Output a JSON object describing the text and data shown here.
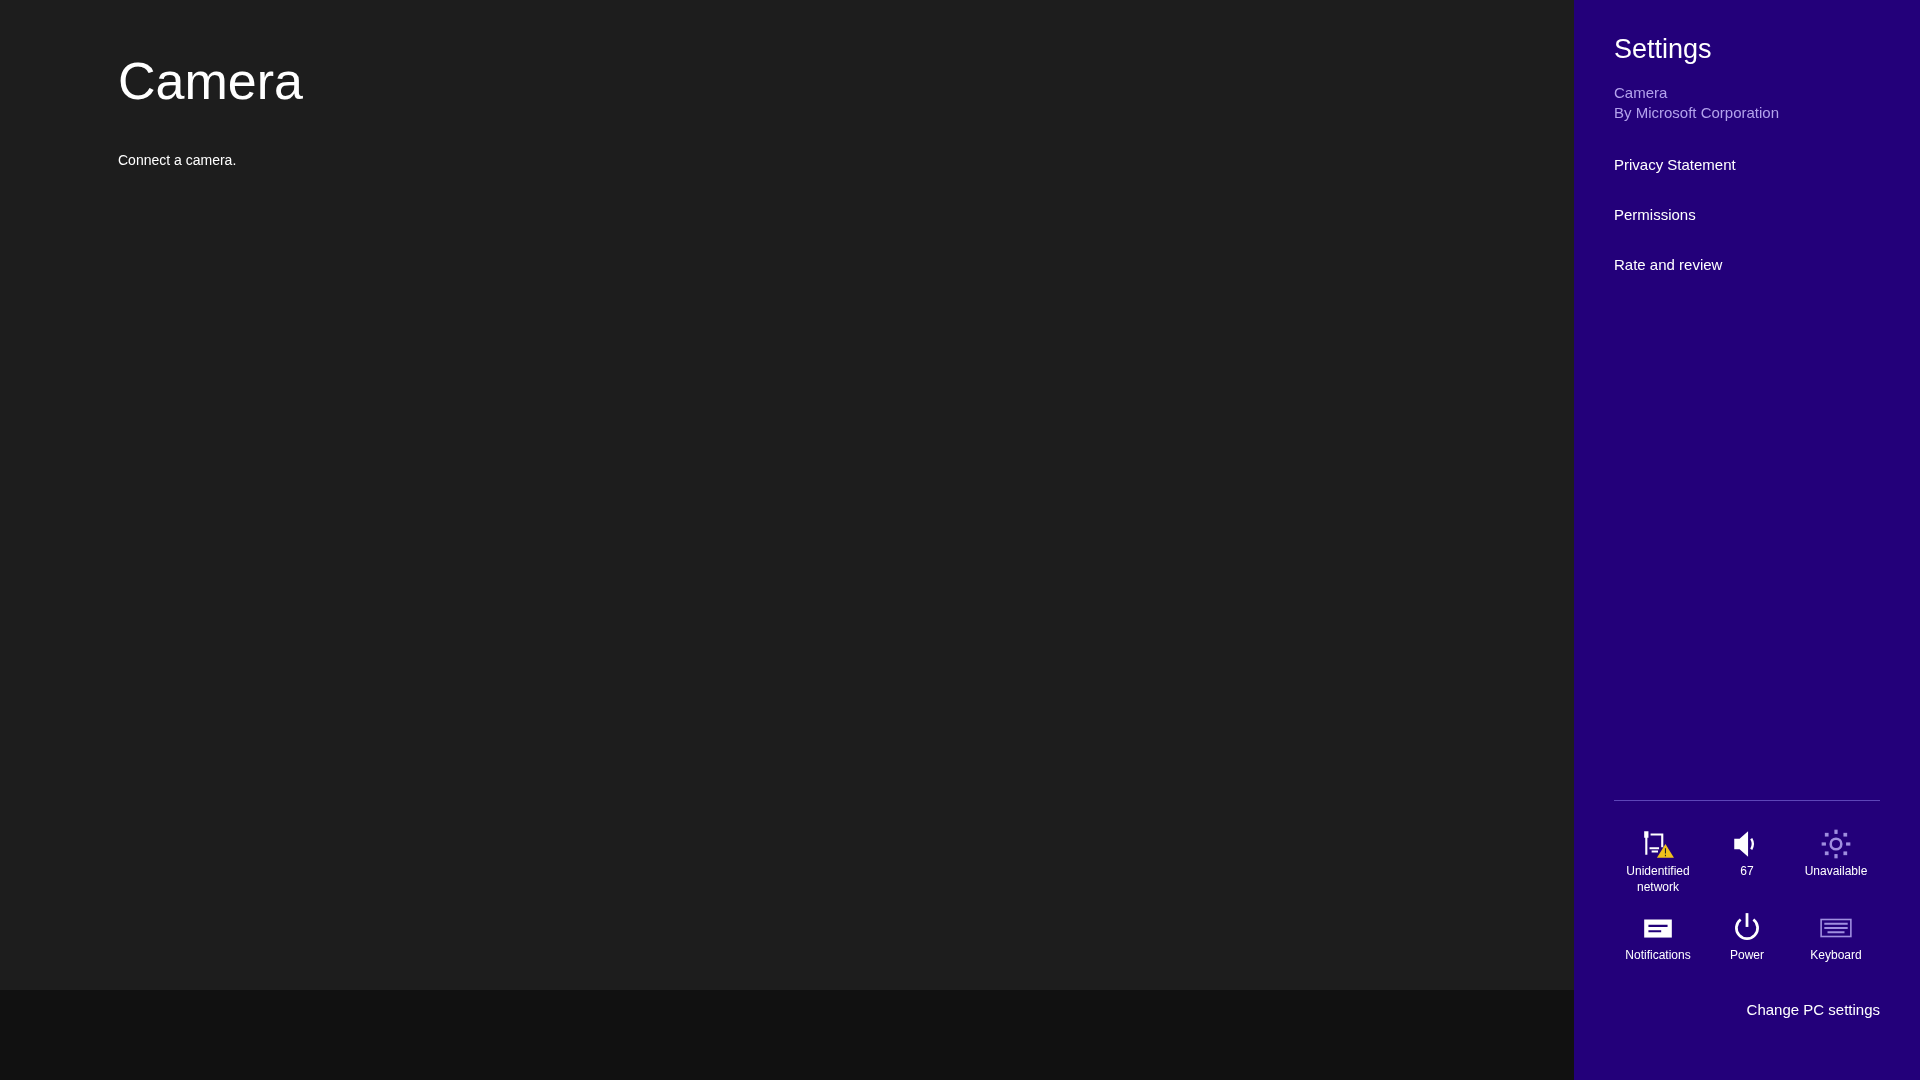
{
  "app": {
    "title": "Camera",
    "message": "Connect a camera."
  },
  "settings": {
    "title": "Settings",
    "app_name": "Camera",
    "publisher": "By Microsoft Corporation",
    "links": [
      "Privacy Statement",
      "Permissions",
      "Rate and review"
    ],
    "tiles": [
      {
        "kind": "network",
        "label": "Unidentified network",
        "disabled": false
      },
      {
        "kind": "volume",
        "label": "67",
        "disabled": false
      },
      {
        "kind": "brightness",
        "label": "Unavailable",
        "disabled": true
      },
      {
        "kind": "notifications",
        "label": "Notifications",
        "disabled": false
      },
      {
        "kind": "power",
        "label": "Power",
        "disabled": false
      },
      {
        "kind": "keyboard",
        "label": "Keyboard",
        "disabled": true
      }
    ],
    "footer_link": "Change PC settings"
  }
}
